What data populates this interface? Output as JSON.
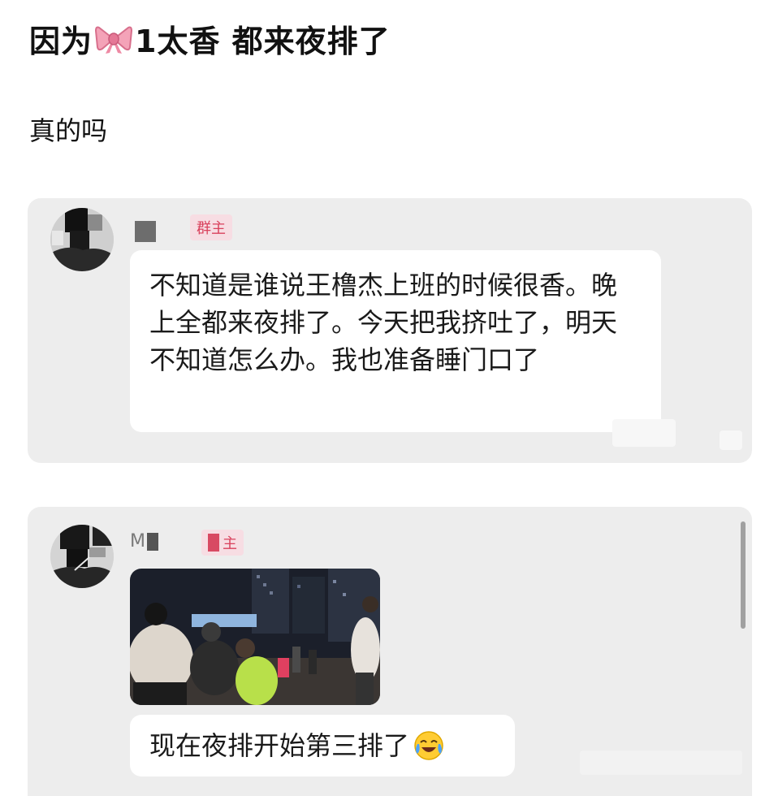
{
  "post": {
    "title_before": "因为",
    "title_after": "1太香 都来夜排了",
    "body": "真的吗"
  },
  "chat": {
    "message_1": {
      "badge": "群主",
      "text": "不知道是谁说王橹杰上班的时候很香。晚上全都来夜排了。今天把我挤吐了，明天不知道怎么办。我也准备睡门口了"
    },
    "message_2": {
      "sender_initial": "M",
      "badge": "主",
      "image_icon": "night-queue-photo",
      "text": "现在夜排开始第三排了",
      "emoji_icon": "laughing-crying-emoji"
    }
  },
  "colors": {
    "card_background": "#ededed",
    "bubble_background": "#ffffff",
    "badge_text": "#d9415c",
    "badge_background": "#f7dde3"
  }
}
